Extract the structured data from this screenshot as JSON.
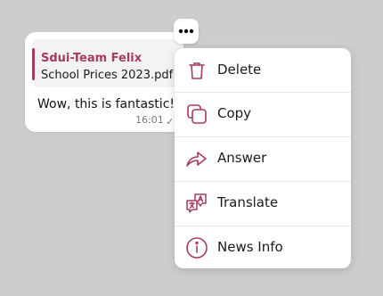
{
  "colors": {
    "accent": "#a83a5a",
    "background": "#cdcdcd",
    "surface": "#ffffff"
  },
  "message": {
    "quote": {
      "sender": "Sdui-Team Felix",
      "file_name": "School Prices 2023.pdf"
    },
    "text": "Wow, this is fantastic!",
    "time": "16:01",
    "status_icon": "check-icon"
  },
  "more_button": {
    "icon": "more-horizontal-icon"
  },
  "menu": {
    "items": [
      {
        "label": "Delete",
        "icon": "trash-icon"
      },
      {
        "label": "Copy",
        "icon": "copy-icon"
      },
      {
        "label": "Answer",
        "icon": "reply-arrow-icon"
      },
      {
        "label": "Translate",
        "icon": "translate-icon"
      },
      {
        "label": "News Info",
        "icon": "info-icon"
      }
    ]
  }
}
